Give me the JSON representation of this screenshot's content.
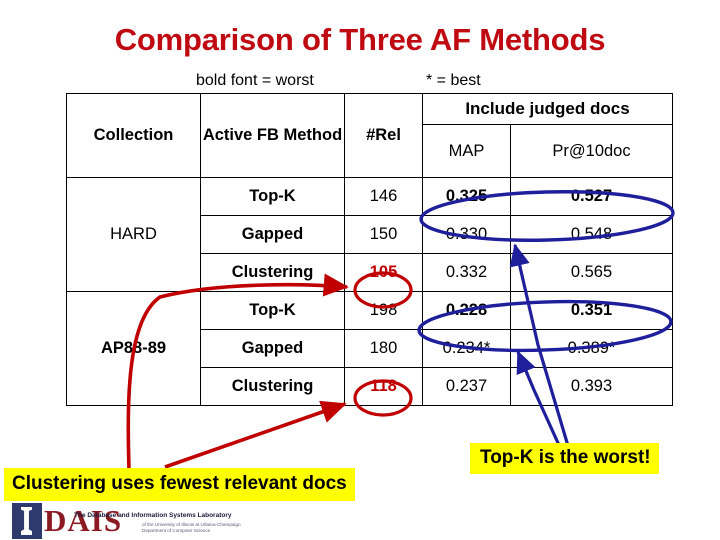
{
  "slide": {
    "title": "Comparison of Three AF Methods",
    "title_color": "#BF0A12"
  },
  "legend": {
    "worst_note": "bold font = worst",
    "best_note": "* = best"
  },
  "table": {
    "group_header": "Include judged docs",
    "columns": [
      "Collection",
      "Active FB Method",
      "#Rel",
      "MAP",
      "Pr@10doc"
    ],
    "groups": [
      {
        "collection": "HARD",
        "rows": [
          {
            "method": "Top-K",
            "nrel": "146",
            "nrel_highlight": false,
            "map": "0.325",
            "pr10": "0.527",
            "bold": true
          },
          {
            "method": "Gapped",
            "nrel": "150",
            "nrel_highlight": false,
            "map": "0.330",
            "pr10": "0.548",
            "bold": false
          },
          {
            "method": "Clustering",
            "nrel": "105",
            "nrel_highlight": true,
            "map": "0.332",
            "pr10": "0.565",
            "bold": false
          }
        ]
      },
      {
        "collection": "AP88-89",
        "rows": [
          {
            "method": "Top-K",
            "nrel": "198",
            "nrel_highlight": false,
            "map": "0.228",
            "pr10": "0.351",
            "bold": true
          },
          {
            "method": "Gapped",
            "nrel": "180",
            "nrel_highlight": false,
            "map": "0.234*",
            "pr10": "0.389*",
            "bold": false
          },
          {
            "method": "Clustering",
            "nrel": "118",
            "nrel_highlight": true,
            "map": "0.237",
            "pr10": "0.393",
            "bold": false
          }
        ]
      }
    ]
  },
  "callouts": {
    "clustering": "Clustering uses fewest relevant docs",
    "topk": "Top-K is the worst!",
    "background_color": "#FFFF00"
  },
  "annotations": {
    "red_color": "#C00000",
    "blue_color": "#1F1F9C",
    "red_circle_targets": [
      "105",
      "118"
    ],
    "blue_ellipse_targets": [
      "HARD Top-K MAP / Pr@10doc",
      "AP88-89 Top-K MAP / Pr@10doc"
    ]
  },
  "logo": {
    "wordmark": "DAIS",
    "tagline": "The Database and Information Systems Laboratory",
    "subtagline_line1": "of the University of Illinois at Urbana-Champaign",
    "subtagline_line2": "Department of Computer Science"
  }
}
